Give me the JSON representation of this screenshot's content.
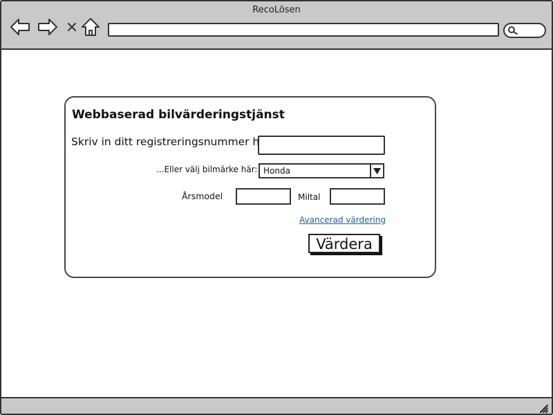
{
  "window": {
    "title": "RecoLösen"
  },
  "browser": {
    "url": "",
    "icons": {
      "back": "back-arrow-icon",
      "forward": "forward-arrow-icon",
      "stop": "close-icon",
      "home": "home-icon",
      "search": "search-icon",
      "resize": "resize-grip-icon"
    }
  },
  "form": {
    "title": "Webbaserad bilvärderingstjänst",
    "reg_label": "Skriv in ditt registreringsnummer här",
    "reg_value": "",
    "make_label": "...Eller välj bilmärke här:",
    "make_selected": "Honda",
    "year_label": "Årsmodel",
    "year_value": "",
    "mileage_label": "Miltal",
    "mileage_value": "",
    "advanced_link": "Avancerad värdering",
    "submit_label": "Värdera"
  },
  "colors": {
    "chrome": "#c9c9c9",
    "border": "#333333",
    "link": "#1f5ea8",
    "background": "#ffffff"
  }
}
